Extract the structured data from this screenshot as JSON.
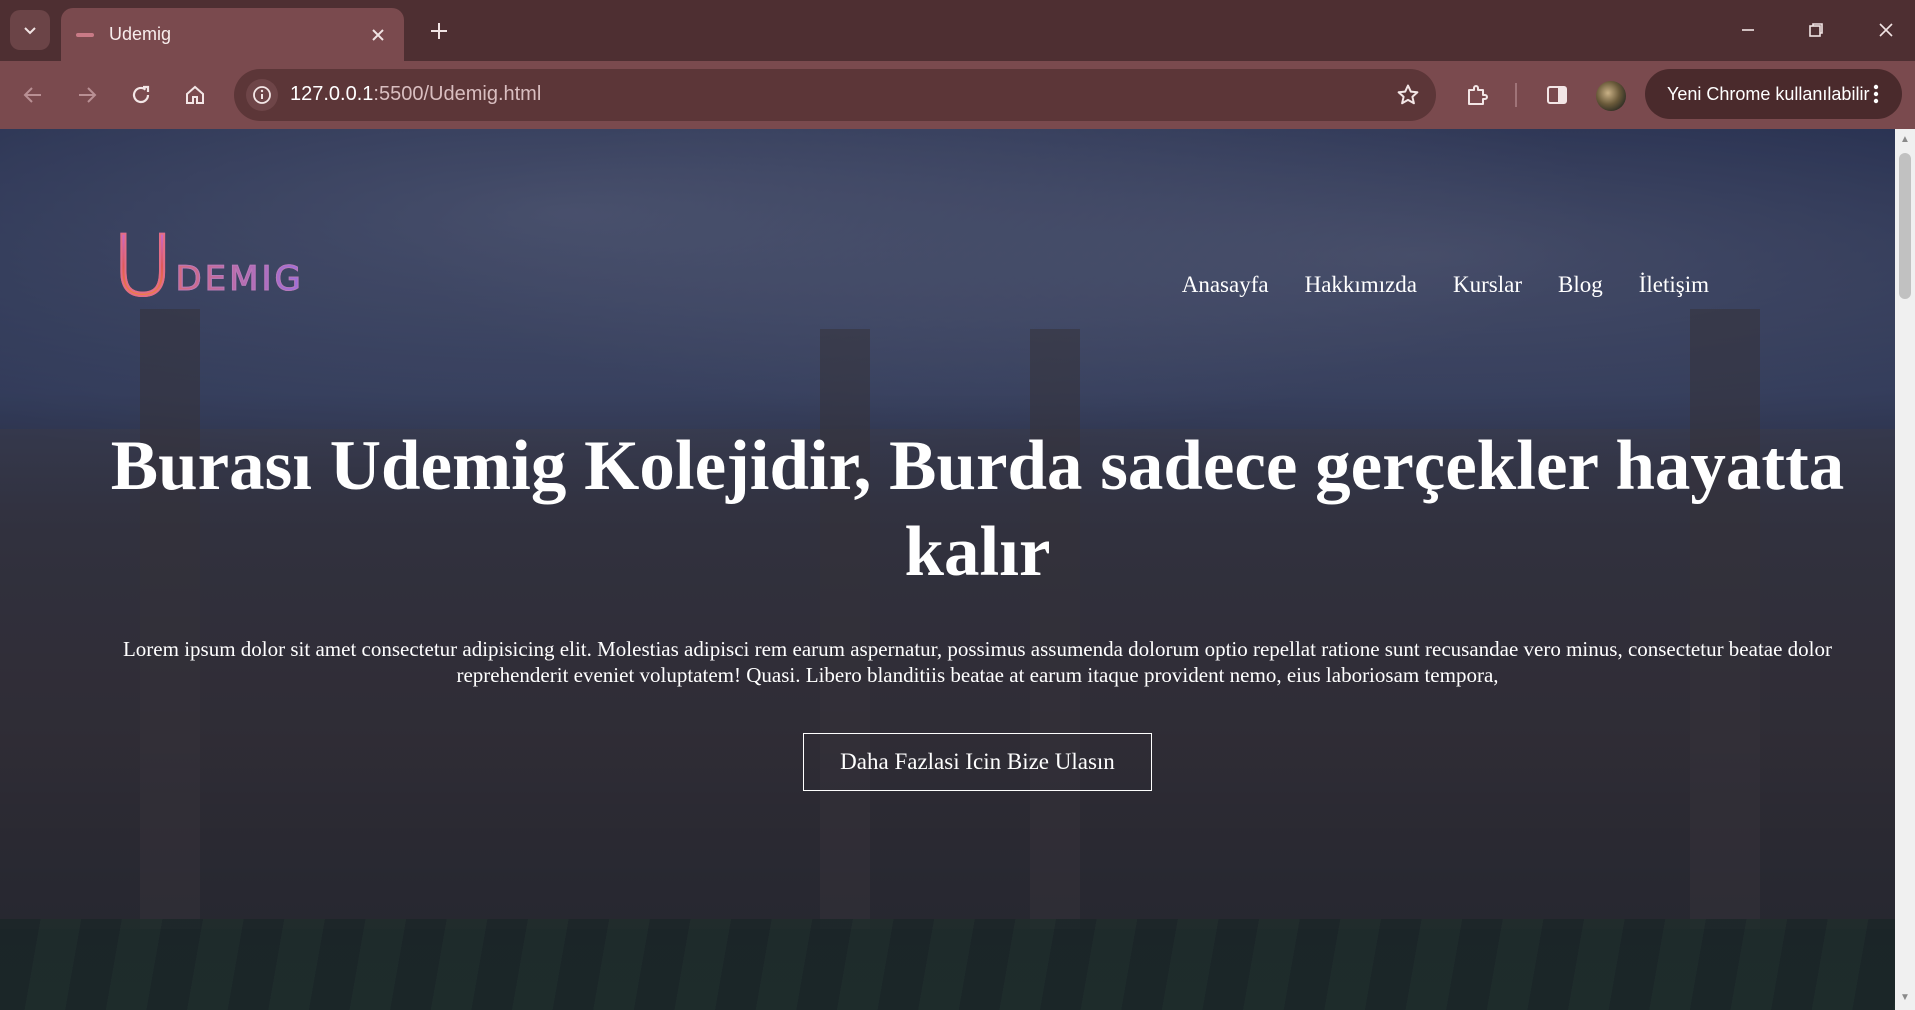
{
  "browser": {
    "tab": {
      "title": "Udemig",
      "close_icon": "close-icon"
    },
    "address": {
      "host": "127.0.0.1",
      "path": ":5500/Udemig.html"
    },
    "update_button": "Yeni Chrome kullanılabilir",
    "colors": {
      "frame": "#4e2f32",
      "toolbar": "#7a4a4e",
      "omnibox": "#5c3638"
    }
  },
  "page": {
    "logo": {
      "initial": "U",
      "rest": "DEMIG"
    },
    "nav": [
      "Anasayfa",
      "Hakkımızda",
      "Kurslar",
      "Blog",
      "İletişim"
    ],
    "headline": "Burası Udemig Kolejidir, Burda sadece gerçekler hayatta kalır",
    "lead": "Lorem ipsum dolor sit amet consectetur adipisicing elit. Molestias adipisci rem earum aspernatur, possimus assumenda dolorum optio repellat ratione sunt recusandae vero minus, consectetur beatae dolor reprehenderit eveniet voluptatem! Quasi. Libero blanditiis beatae at earum itaque provident nemo, eius laboriosam tempora,",
    "cta": "Daha Fazlasi Icin Bize Ulasın"
  }
}
